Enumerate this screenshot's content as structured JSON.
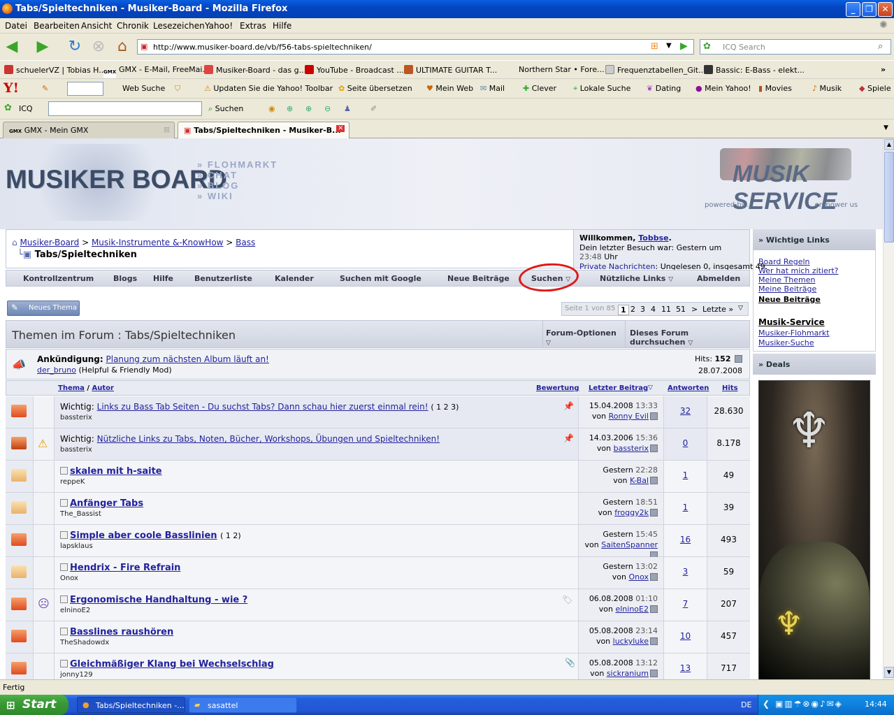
{
  "window": {
    "title": "Tabs/Spieltechniken - Musiker-Board - Mozilla Firefox"
  },
  "menu": [
    "Datei",
    "Bearbeiten",
    "Ansicht",
    "Chronik",
    "Lesezeichen",
    "Yahoo!",
    "Extras",
    "Hilfe"
  ],
  "nav": {
    "url": "http://www.musiker-board.de/vb/f56-tabs-spieltechniken/",
    "search_placeholder": "ICQ Search"
  },
  "bookmarks": [
    "schuelerVZ | Tobias H...",
    "GMX - E-Mail, FreeMai...",
    "Musiker-Board - das g...",
    "YouTube - Broadcast ...",
    "ULTIMATE GUITAR T...",
    "Northern Star • Fore...",
    "Frequenztabellen_Git...",
    "Bassic: E-Bass - elekt..."
  ],
  "yahoo": {
    "search": "Web Suche",
    "items": [
      "Updaten Sie die Yahoo! Toolbar",
      "Seite übersetzen",
      "Mein Web",
      "Mail",
      "Clever",
      "Lokale Suche",
      "Dating",
      "Mein Yahoo!",
      "Movies",
      "Musik",
      "Spiele"
    ]
  },
  "icq": {
    "label": "ICQ",
    "search": "Suchen"
  },
  "tabs": [
    {
      "label": "GMX - Mein GMX"
    },
    {
      "label": "Tabs/Spieltechniken - Musiker-B..."
    }
  ],
  "header": {
    "logo": "MUSIKER BOARD",
    "links": [
      "FLOHMARKT",
      "CHAT",
      "BLOG",
      "WIKI"
    ],
    "sponsor": "MUSIK SERVICE",
    "powered": "powered by...",
    "empower": "...empower us"
  },
  "breadcrumb": {
    "items": [
      "Musiker-Board",
      "Musik-Instrumente &-KnowHow",
      "Bass"
    ],
    "current": "Tabs/Spieltechniken"
  },
  "welcome": {
    "greeting": "Willkommen, ",
    "user": "Tobbse",
    "last_visit_label": "Dein letzter Besuch war: Gestern um ",
    "last_visit_time": "23:48",
    "last_visit_suffix": " Uhr",
    "pm_link": "Private Nachrichten",
    "pm_text": ": Ungelesen 0, insgesamt 49."
  },
  "navstrip": [
    "Kontrollzentrum",
    "Blogs",
    "Hilfe",
    "Benutzerliste",
    "Kalender",
    "Suchen mit Google",
    "Neue Beiträge",
    "Suchen",
    "Nützliche Links",
    "Abmelden"
  ],
  "new_thread": "Neues Thema",
  "pagination": {
    "label": "Seite 1 von 85",
    "pages": [
      "1",
      "2",
      "3",
      "4",
      "11",
      "51",
      ">",
      "Letzte »"
    ]
  },
  "forum": {
    "title": "Themen im Forum : Tabs/Spieltechniken",
    "options": "Forum-Optionen",
    "search": "Dieses Forum durchsuchen"
  },
  "announcement": {
    "label": "Ankündigung:",
    "title": "Planung zum nächsten Album läuft an!",
    "author": "der_bruno",
    "author_role": "(Helpful & Friendly Mod)",
    "hits_label": "Hits:",
    "hits": "152",
    "date": "28.07.2008"
  },
  "columns": {
    "thema": "Thema",
    "sep": " / ",
    "autor": "Autor",
    "bewertung": "Bewertung",
    "letzter": "Letzter Beitrag",
    "antworten": "Antworten",
    "hits": "Hits"
  },
  "threads": [
    {
      "prefix": "Wichtig: ",
      "title": "Links zu Bass Tab Seiten - Du suchst Tabs? Dann schau hier zuerst einmal rein!",
      "pages": "( 1 2 3)",
      "author": "bassterix",
      "date": "15.04.2008",
      "time": "13:33",
      "by": "Ronny Evil",
      "replies": "32",
      "hits": "28.630"
    },
    {
      "prefix": "Wichtig: ",
      "title": "Nützliche Links zu Tabs, Noten, Bücher, Workshops, Übungen und Spieltechniken!",
      "pages": "",
      "author": "bassterix",
      "date": "14.03.2006",
      "time": "15:36",
      "by": "bassterix",
      "replies": "0",
      "hits": "8.178"
    },
    {
      "prefix": "",
      "title": "skalen mit h-saite",
      "pages": "",
      "author": "reppeK",
      "date": "Gestern",
      "time": "22:28",
      "by": "K-Bal",
      "replies": "1",
      "hits": "49"
    },
    {
      "prefix": "",
      "title": "Anfänger Tabs",
      "pages": "",
      "author": "The_Bassist",
      "date": "Gestern",
      "time": "18:51",
      "by": "froggy2k",
      "replies": "1",
      "hits": "39"
    },
    {
      "prefix": "",
      "title": "Simple aber coole Basslinien",
      "pages": "( 1 2)",
      "author": "lapsklaus",
      "date": "Gestern",
      "time": "15:45",
      "by": "SaitenSpanner",
      "replies": "16",
      "hits": "493"
    },
    {
      "prefix": "",
      "title": "Hendrix - Fire Refrain",
      "pages": "",
      "author": "Onox",
      "date": "Gestern",
      "time": "13:02",
      "by": "Onox",
      "replies": "3",
      "hits": "59"
    },
    {
      "prefix": "",
      "title": "Ergonomische Handhaltung - wie ?",
      "pages": "",
      "author": "elninoE2",
      "date": "06.08.2008",
      "time": "01:10",
      "by": "elninoE2",
      "replies": "7",
      "hits": "207"
    },
    {
      "prefix": "",
      "title": "Basslines raushören",
      "pages": "",
      "author": "TheShadowdx",
      "date": "05.08.2008",
      "time": "23:14",
      "by": "luckyluke",
      "replies": "10",
      "hits": "457"
    },
    {
      "prefix": "",
      "title": "Gleichmäßiger Klang bei Wechselschlag",
      "pages": "",
      "author": "jonny129",
      "date": "05.08.2008",
      "time": "13:12",
      "by": "sickranium",
      "replies": "13",
      "hits": "717"
    }
  ],
  "by_label": "von ",
  "sidebar": {
    "important": "» Wichtige Links",
    "links": [
      "Board Regeln",
      "Wer hat mich zitiert?",
      "Meine Themen",
      "Meine Beiträge",
      "Neue Beiträge"
    ],
    "musik_service": "Musik-Service",
    "ms_links": [
      "Musiker-Flohmarkt",
      "Musiker-Suche"
    ],
    "deals": "» Deals"
  },
  "status": "Fertig",
  "taskbar": {
    "start": "Start",
    "items": [
      "Tabs/Spieltechniken -...",
      "sasattel"
    ],
    "lang": "DE",
    "clock": "14:44"
  }
}
